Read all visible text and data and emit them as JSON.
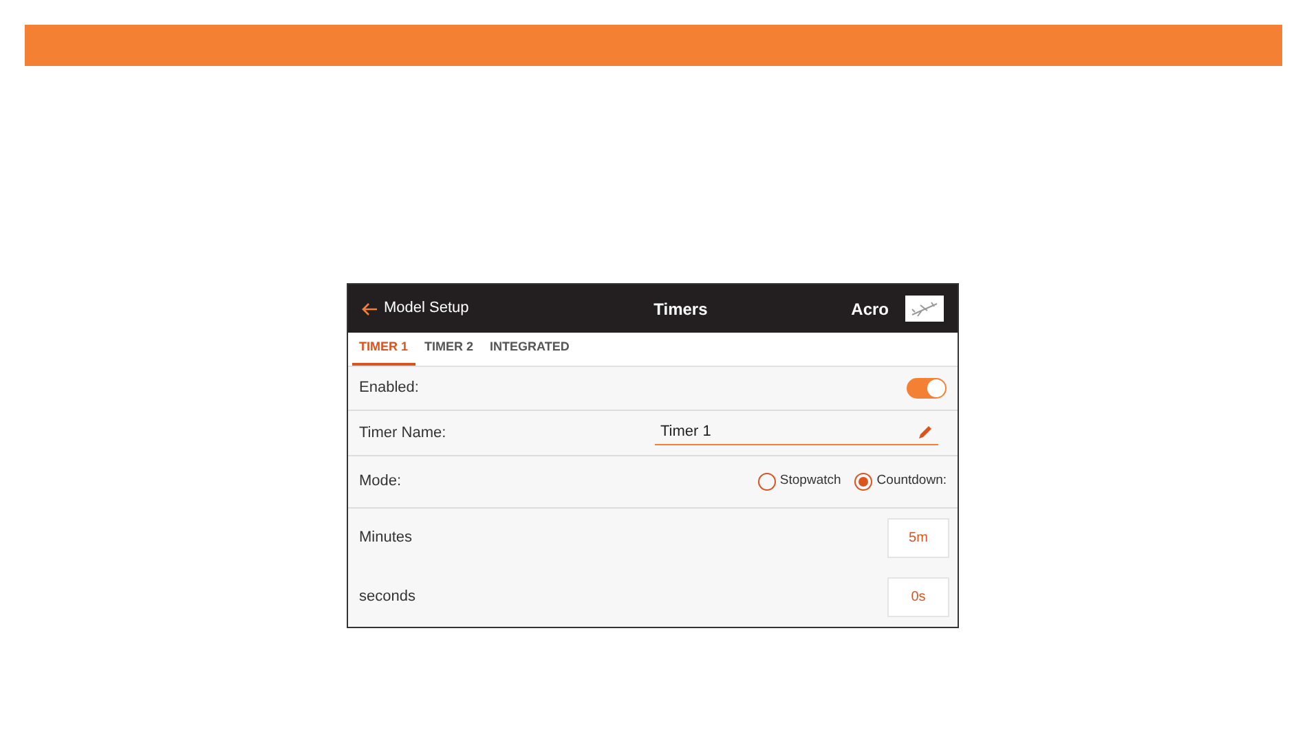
{
  "header": {
    "back": "Model Setup",
    "title": "Timers",
    "model": "Acro"
  },
  "tabs": [
    {
      "label": "TIMER 1",
      "selected": true
    },
    {
      "label": "TIMER 2",
      "selected": false
    },
    {
      "label": "INTEGRATED",
      "selected": false
    }
  ],
  "enabled": {
    "label": "Enabled:",
    "on": true
  },
  "timer_name": {
    "label": "Timer Name:",
    "value": "Timer 1"
  },
  "mode": {
    "label": "Mode:",
    "options": [
      {
        "label": "Stopwatch",
        "selected": false
      },
      {
        "label": "Countdown:",
        "selected": true
      }
    ]
  },
  "values": [
    {
      "label": "Minutes",
      "value": "5m"
    },
    {
      "label": "seconds",
      "value": "0s"
    }
  ]
}
